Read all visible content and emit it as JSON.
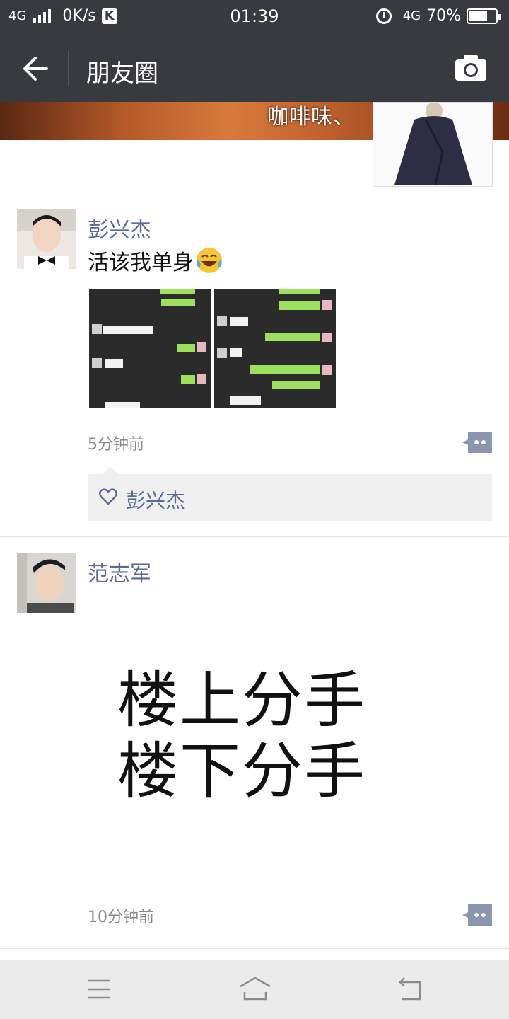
{
  "status_bar": {
    "network_left": "4G",
    "speed": "0K/s",
    "k_badge": "K",
    "time": "01:39",
    "network_right": "4G",
    "battery": "70%",
    "battery_level": 0.7
  },
  "nav": {
    "title": "朋友圈",
    "back_icon": "arrow-left-icon",
    "camera_icon": "camera-icon"
  },
  "cover": {
    "text": "咖啡味、"
  },
  "posts": [
    {
      "username": "彭兴杰",
      "text": "活该我单身",
      "emoji": "tears-of-joy-emoji",
      "time": "5分钟前",
      "likes": [
        "彭兴杰"
      ]
    },
    {
      "username": "范志军",
      "image_lines": [
        "楼上分手",
        "楼下分手"
      ],
      "time": "10分钟前"
    }
  ],
  "colors": {
    "bar": "#393a3f",
    "name_link": "#576b95",
    "timestamp": "#8a8a8a"
  }
}
